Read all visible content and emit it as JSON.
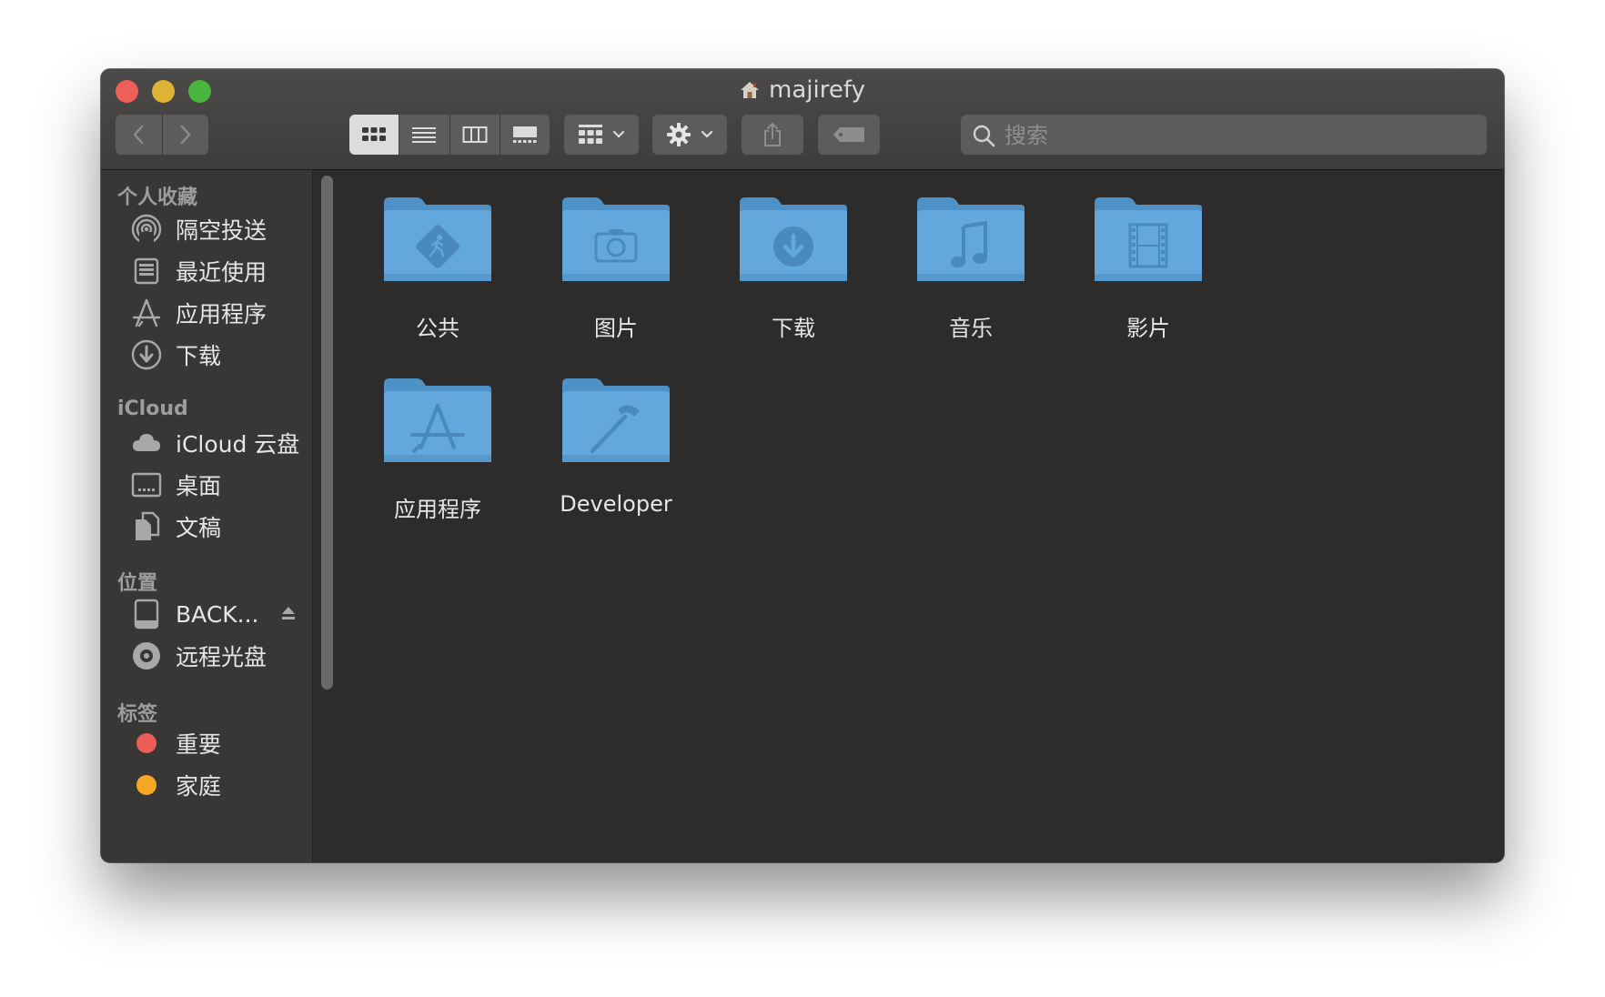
{
  "window": {
    "title": "majirefy"
  },
  "toolbar": {
    "back_icon": "chevron-left-icon",
    "forward_icon": "chevron-right-icon",
    "view_modes": [
      "icon-view",
      "list-view",
      "column-view",
      "gallery-view"
    ],
    "active_view": "icon-view",
    "search_placeholder": "搜索"
  },
  "sidebar": {
    "sections": [
      {
        "header": "个人收藏",
        "items": [
          {
            "label": "隔空投送",
            "icon": "airdrop-icon"
          },
          {
            "label": "最近使用",
            "icon": "recents-icon"
          },
          {
            "label": "应用程序",
            "icon": "applications-icon"
          },
          {
            "label": "下载",
            "icon": "downloads-icon"
          }
        ]
      },
      {
        "header": "iCloud",
        "items": [
          {
            "label": "iCloud 云盘",
            "icon": "cloud-icon"
          },
          {
            "label": "桌面",
            "icon": "desktop-icon"
          },
          {
            "label": "文稿",
            "icon": "documents-icon"
          }
        ]
      },
      {
        "header": "位置",
        "items": [
          {
            "label": "BACK...",
            "icon": "drive-icon"
          },
          {
            "label": "远程光盘",
            "icon": "disc-icon"
          }
        ]
      },
      {
        "header": "标签",
        "items": [
          {
            "label": "重要",
            "icon": "tag-red-icon",
            "color": "#ec5d57"
          },
          {
            "label": "家庭",
            "icon": "tag-orange-icon",
            "color": "#f5a623"
          }
        ]
      }
    ]
  },
  "files": [
    {
      "name": "公共",
      "icon": "public-folder-icon"
    },
    {
      "name": "图片",
      "icon": "pictures-folder-icon"
    },
    {
      "name": "下载",
      "icon": "downloads-folder-icon"
    },
    {
      "name": "音乐",
      "icon": "music-folder-icon"
    },
    {
      "name": "影片",
      "icon": "movies-folder-icon"
    },
    {
      "name": "应用程序",
      "icon": "applications-folder-icon"
    },
    {
      "name": "Developer",
      "icon": "developer-folder-icon"
    }
  ],
  "colors": {
    "folder": "#62a8dc",
    "folder_glyph": "#4a89bb",
    "window_bg": "#2d2c2a",
    "sidebar_bg": "#383735"
  }
}
